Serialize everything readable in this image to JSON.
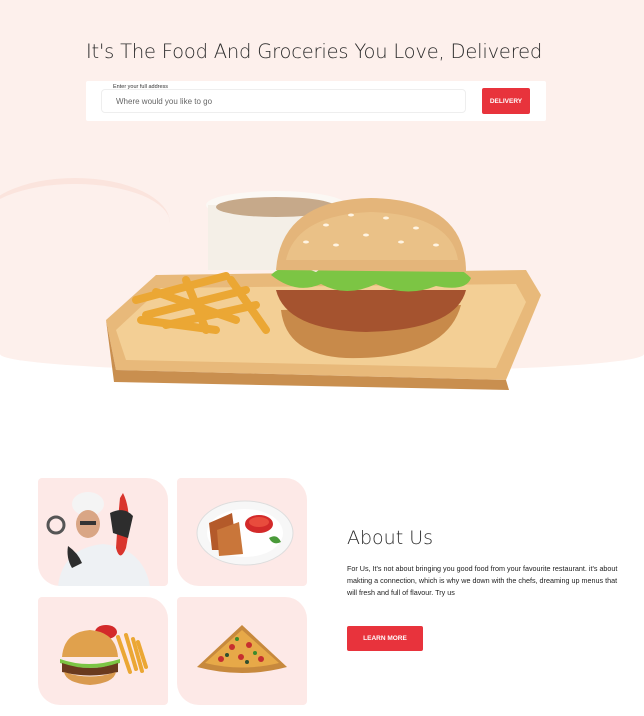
{
  "hero": {
    "title": "It's The Food And Groceries You Love, Delivered",
    "search": {
      "label": "Enter your full address",
      "placeholder": "Where would you like to go",
      "button_label": "DELIVERY"
    },
    "image": "burger-and-fries-on-wooden-tray"
  },
  "about": {
    "title": "About Us",
    "text": "For Us, It's not about bringing you good food from your favourite restaurant. it's about makting a connection, which is why we down with the chefs, dreaming up menus that will fresh and full of flavour. Try us",
    "button_label": "LEARN MORE"
  },
  "gallery": [
    {
      "image": "chef-with-chili-pepper"
    },
    {
      "image": "grilled-chicken-plate-with-sauce"
    },
    {
      "image": "burger-with-fries"
    },
    {
      "image": "pizza-slice"
    }
  ],
  "colors": {
    "accent": "#e8333c",
    "hero_background": "#fdf0ec",
    "tile_background": "#fde9e7"
  }
}
